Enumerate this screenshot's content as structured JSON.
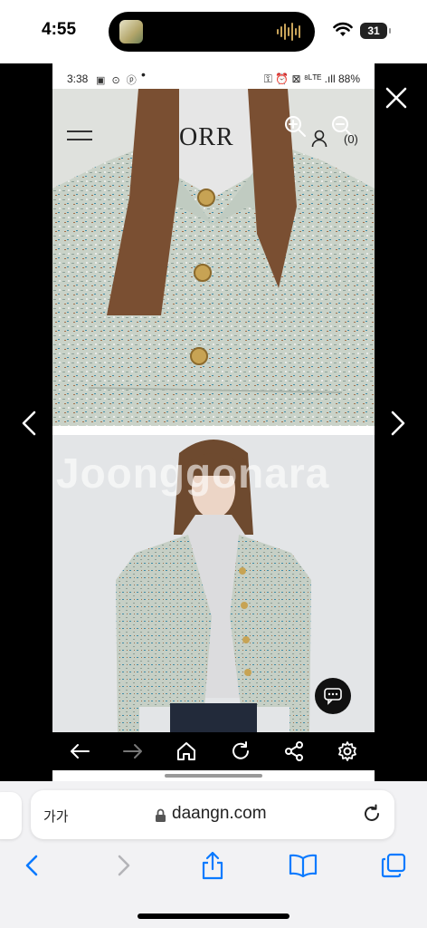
{
  "ios_status": {
    "time": "4:55",
    "battery": "31"
  },
  "android_status": {
    "time": "3:38",
    "icons": "▣ ⊙ ⓟ",
    "dot": "•",
    "right": "⚿ ⏰ ⊠ ⁸ᴸᵀᴱ .ıll 88%"
  },
  "site": {
    "brand": "ORR",
    "cart_count": "(0)"
  },
  "watermark": "Joonggonara",
  "browser_url": {
    "text_size": "가가",
    "domain": "daangn.com"
  },
  "colors": {
    "accent": "#0a7aff",
    "toolbar": "#000000",
    "jacket": "#c7d1c7",
    "hair": "#7a4f32"
  }
}
